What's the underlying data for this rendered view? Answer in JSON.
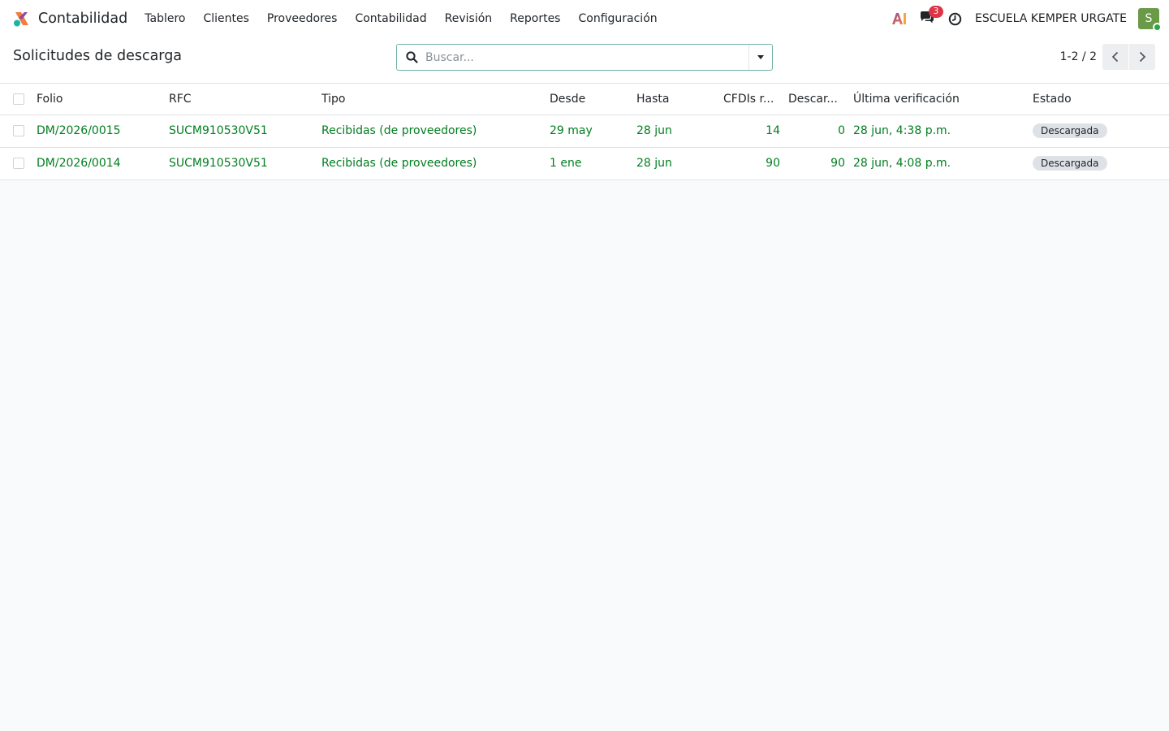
{
  "navbar": {
    "app_name": "Contabilidad",
    "menu": [
      {
        "label": "Tablero"
      },
      {
        "label": "Clientes"
      },
      {
        "label": "Proveedores"
      },
      {
        "label": "Contabilidad"
      },
      {
        "label": "Revisión"
      },
      {
        "label": "Reportes"
      },
      {
        "label": "Configuración"
      }
    ],
    "notification_count": "3",
    "company": "ESCUELA KEMPER URGATE",
    "avatar_initial": "S"
  },
  "control_panel": {
    "title": "Solicitudes de descarga",
    "search_placeholder": "Buscar...",
    "pager_text": "1-2 / 2"
  },
  "table": {
    "headers": {
      "folio": "Folio",
      "rfc": "RFC",
      "tipo": "Tipo",
      "desde": "Desde",
      "hasta": "Hasta",
      "cfdis": "CFDIs r...",
      "descargados": "Descar...",
      "ultima": "Última verificación",
      "estado": "Estado"
    },
    "rows": [
      {
        "folio": "DM/2026/0015",
        "rfc": "SUCM910530V51",
        "tipo": "Recibidas (de proveedores)",
        "desde": "29 may",
        "hasta": "28 jun",
        "cfdis": "14",
        "descargados": "0",
        "ultima": "28 jun, 4:38 p.m.",
        "estado": "Descargada"
      },
      {
        "folio": "DM/2026/0014",
        "rfc": "SUCM910530V51",
        "tipo": "Recibidas (de proveedores)",
        "desde": "1 ene",
        "hasta": "28 jun",
        "cfdis": "90",
        "descargados": "90",
        "ultima": "28 jun, 4:08 p.m.",
        "estado": "Descargada"
      }
    ]
  },
  "colors": {
    "link_green": "#017e1f",
    "badge_red": "#dc3545",
    "avatar_green": "#6a9a48",
    "search_border": "#71b1a6"
  },
  "icons": {
    "app_logo": "accounting-logo-icon",
    "ai": "ai-icon",
    "chat": "chat-icon",
    "clock": "clock-icon",
    "search": "search-icon",
    "prev": "chevron-left-icon",
    "next": "chevron-right-icon"
  }
}
